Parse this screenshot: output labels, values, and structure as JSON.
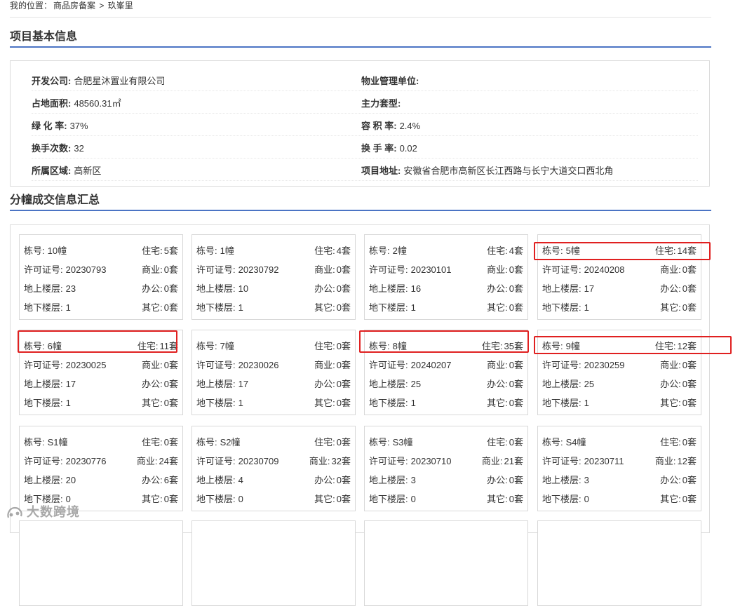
{
  "breadcrumb": {
    "label": "我的位置：",
    "level1": "商品房备案",
    "separator": ">",
    "level2": "玖峯里"
  },
  "section_basic": {
    "title": "项目基本信息"
  },
  "basic_info": {
    "rows": [
      {
        "left_label": "开发公司:",
        "left_value": "合肥星沐置业有限公司",
        "right_label": "物业管理单位:",
        "right_value": ""
      },
      {
        "left_label": "占地面积:",
        "left_value": "48560.31㎡",
        "right_label": "主力套型:",
        "right_value": ""
      },
      {
        "left_label": "绿 化 率:",
        "left_value": "37%",
        "right_label": "容 积 率:",
        "right_value": "2.4%"
      },
      {
        "left_label": "换手次数:",
        "left_value": "32",
        "right_label": "换 手 率:",
        "right_value": "0.02"
      },
      {
        "left_label": "所属区域:",
        "left_value": "高新区",
        "right_label": "项目地址:",
        "right_value": "安徽省合肥市高新区长江西路与长宁大道交口西北角"
      }
    ]
  },
  "section_buildings": {
    "title": "分幢成交信息汇总"
  },
  "labels": {
    "building": "栋号:",
    "residential": "住宅:",
    "permit": "许可证号:",
    "commercial": "商业:",
    "above": "地上楼层:",
    "office": "办公:",
    "below": "地下楼层:",
    "other": "其它:"
  },
  "buildings": [
    {
      "name": "10幢",
      "residential": "5套",
      "permit": "20230793",
      "commercial": "0套",
      "above": "23",
      "office": "0套",
      "below": "1",
      "other": "0套"
    },
    {
      "name": "1幢",
      "residential": "4套",
      "permit": "20230792",
      "commercial": "0套",
      "above": "10",
      "office": "0套",
      "below": "1",
      "other": "0套"
    },
    {
      "name": "2幢",
      "residential": "4套",
      "permit": "20230101",
      "commercial": "0套",
      "above": "16",
      "office": "0套",
      "below": "1",
      "other": "0套"
    },
    {
      "name": "5幢",
      "residential": "14套",
      "permit": "20240208",
      "commercial": "0套",
      "above": "17",
      "office": "0套",
      "below": "1",
      "other": "0套"
    },
    {
      "name": "6幢",
      "residential": "11套",
      "permit": "20230025",
      "commercial": "0套",
      "above": "17",
      "office": "0套",
      "below": "1",
      "other": "0套"
    },
    {
      "name": "7幢",
      "residential": "0套",
      "permit": "20230026",
      "commercial": "0套",
      "above": "17",
      "office": "0套",
      "below": "1",
      "other": "0套"
    },
    {
      "name": "8幢",
      "residential": "35套",
      "permit": "20240207",
      "commercial": "0套",
      "above": "25",
      "office": "0套",
      "below": "1",
      "other": "0套"
    },
    {
      "name": "9幢",
      "residential": "12套",
      "permit": "20230259",
      "commercial": "0套",
      "above": "25",
      "office": "0套",
      "below": "1",
      "other": "0套"
    },
    {
      "name": "S1幢",
      "residential": "0套",
      "permit": "20230776",
      "commercial": "24套",
      "above": "20",
      "office": "6套",
      "below": "0",
      "other": "0套"
    },
    {
      "name": "S2幢",
      "residential": "0套",
      "permit": "20230709",
      "commercial": "32套",
      "above": "4",
      "office": "0套",
      "below": "0",
      "other": "0套"
    },
    {
      "name": "S3幢",
      "residential": "0套",
      "permit": "20230710",
      "commercial": "21套",
      "above": "3",
      "office": "0套",
      "below": "0",
      "other": "0套"
    },
    {
      "name": "S4幢",
      "residential": "0套",
      "permit": "20230711",
      "commercial": "12套",
      "above": "3",
      "office": "0套",
      "below": "0",
      "other": "0套"
    }
  ],
  "highlight_color": "#e02020",
  "accent_color": "#4b74c4",
  "watermark": {
    "icon": "logo-icon",
    "text": "大数跨境"
  }
}
